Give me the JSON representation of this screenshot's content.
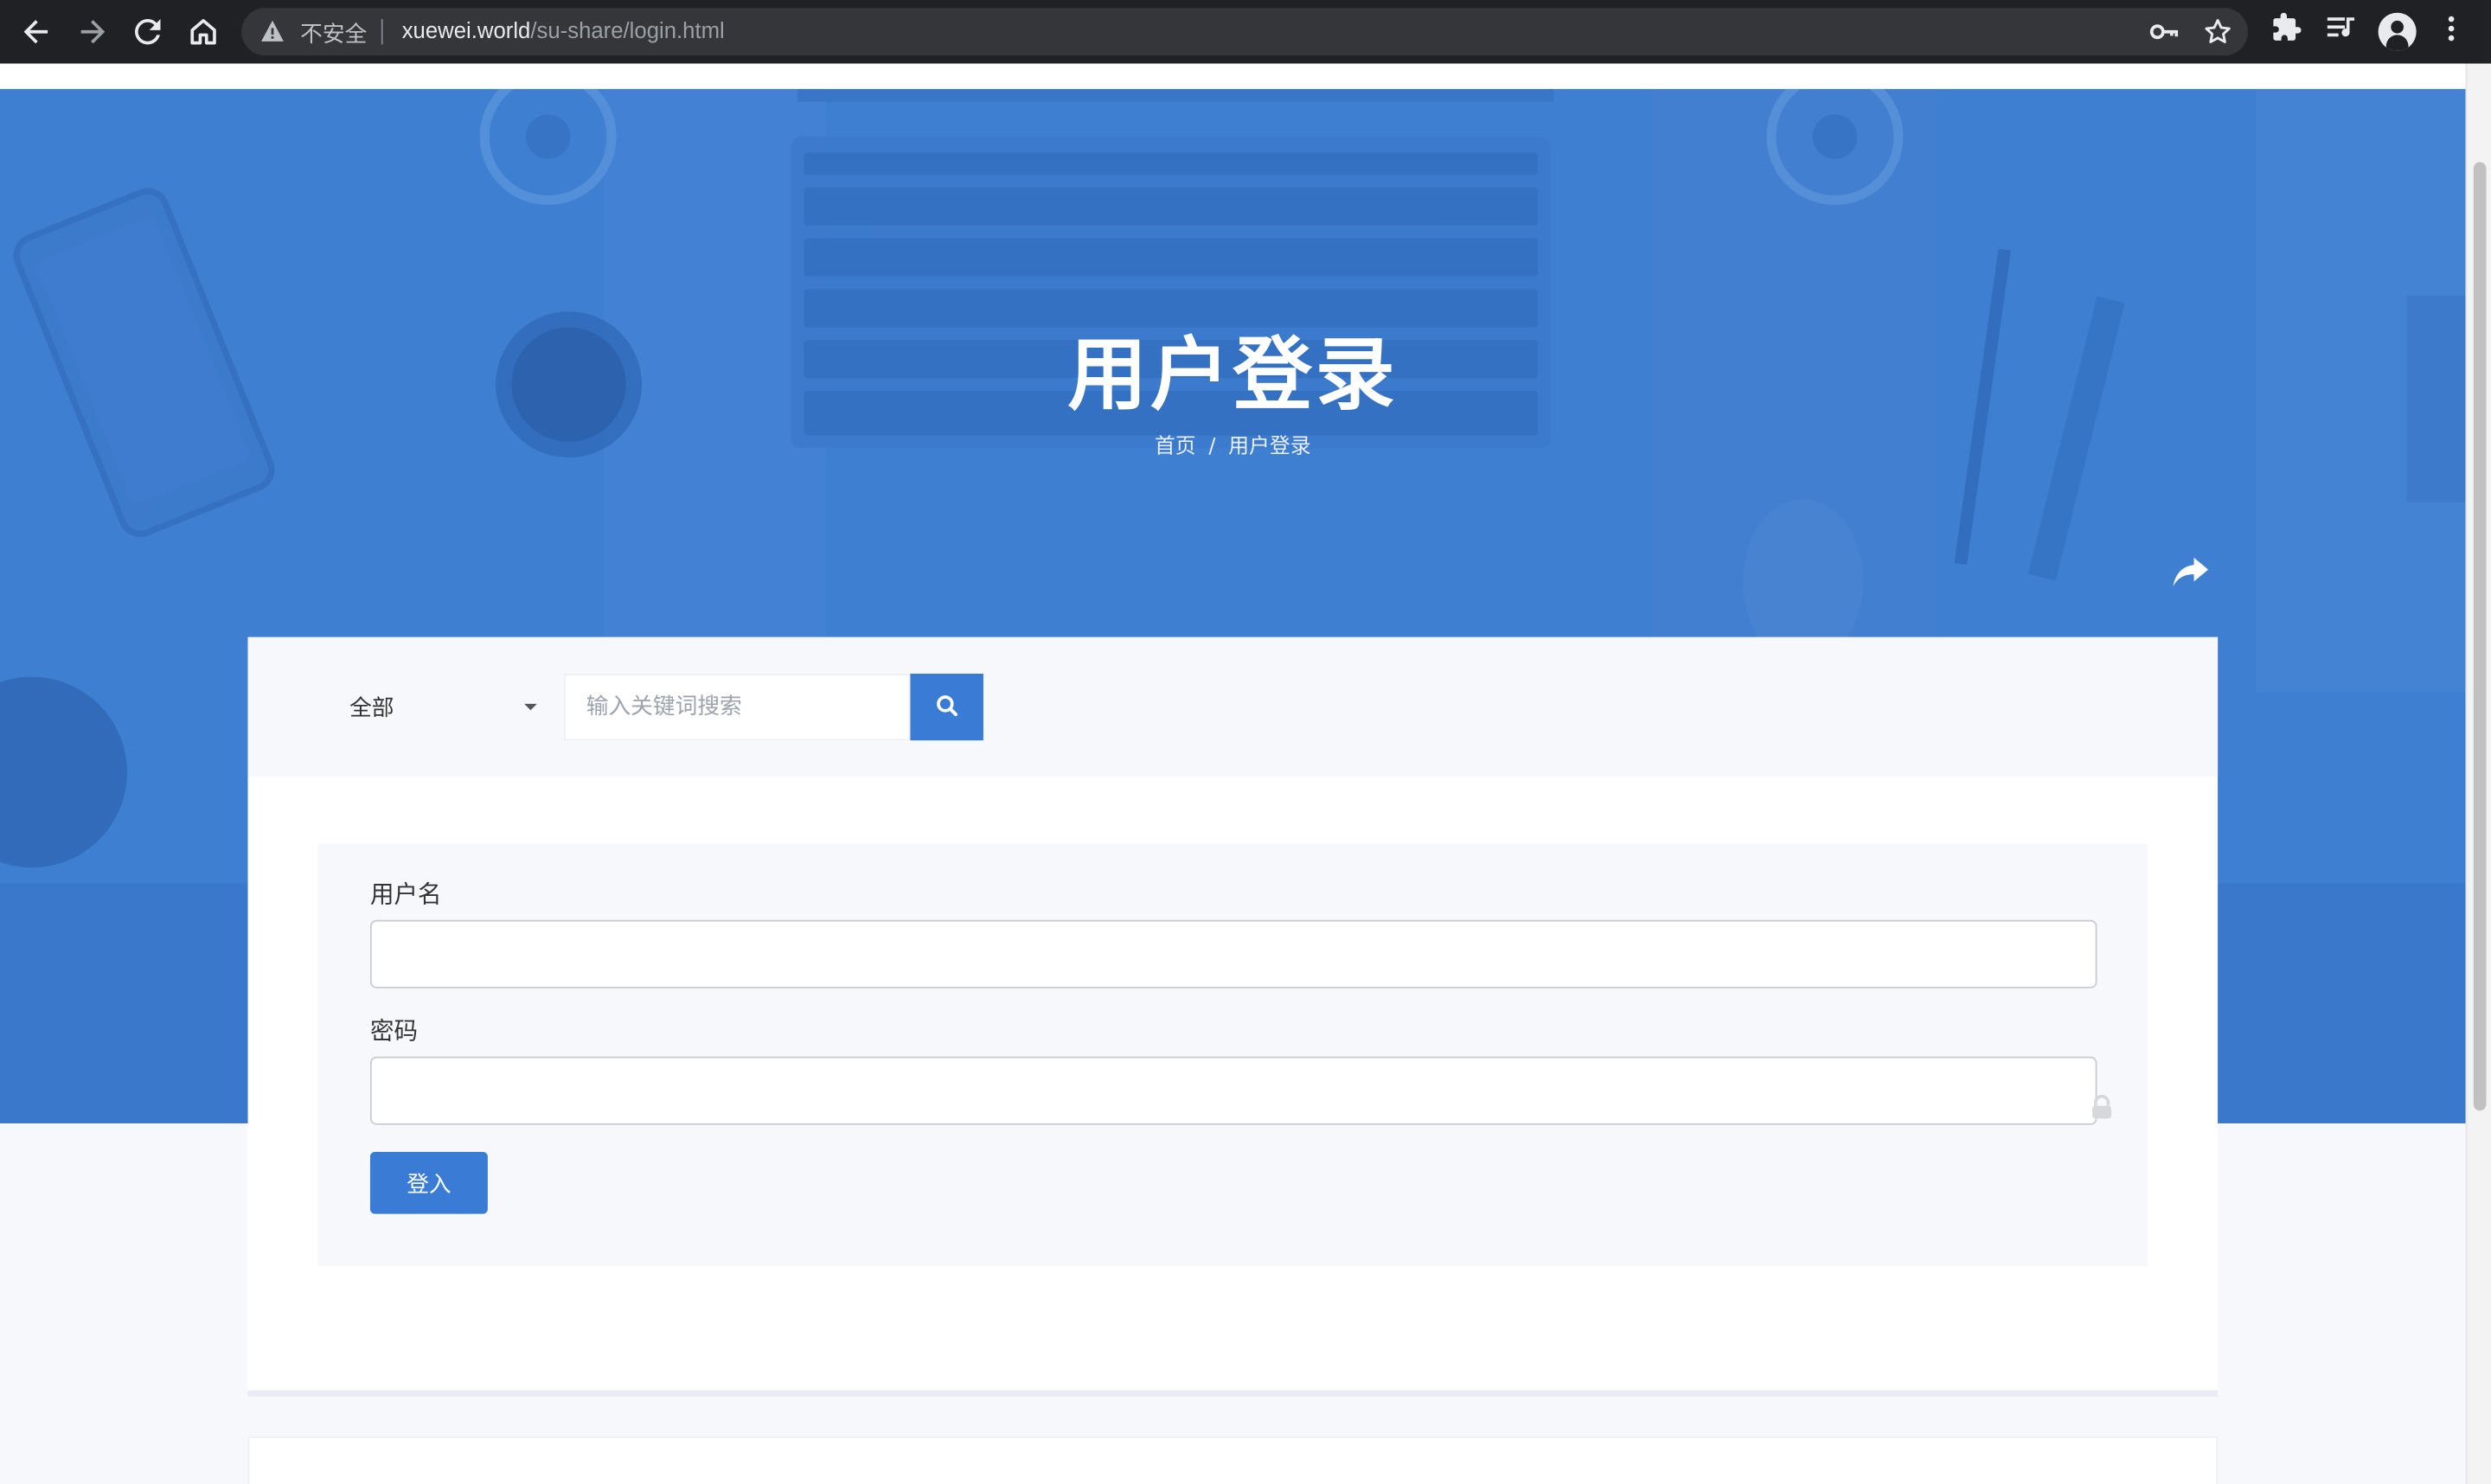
{
  "browser": {
    "security_label": "不安全",
    "url_host": "xuewei.world",
    "url_path": "/su-share/login.html",
    "icons": [
      "back-arrow-icon",
      "forward-arrow-icon",
      "reload-icon",
      "home-icon",
      "warning-icon",
      "key-icon",
      "star-icon",
      "puzzle-icon",
      "reading-list-icon",
      "profile-icon",
      "more-vertical-icon"
    ]
  },
  "hero": {
    "title": "用户登录",
    "breadcrumb": {
      "home": "首页",
      "separator": "/",
      "current": "用户登录"
    },
    "background_color": "#3f7fd2"
  },
  "search": {
    "category_selected": "全部",
    "placeholder": "输入关键词搜索",
    "value": ""
  },
  "login_form": {
    "username_label": "用户名",
    "username_value": "",
    "password_label": "密码",
    "password_value": "",
    "submit_label": "登入"
  },
  "colors": {
    "accent": "#3a7bd5",
    "chrome_bg": "#202124",
    "page_bg": "#f7f8fb"
  }
}
